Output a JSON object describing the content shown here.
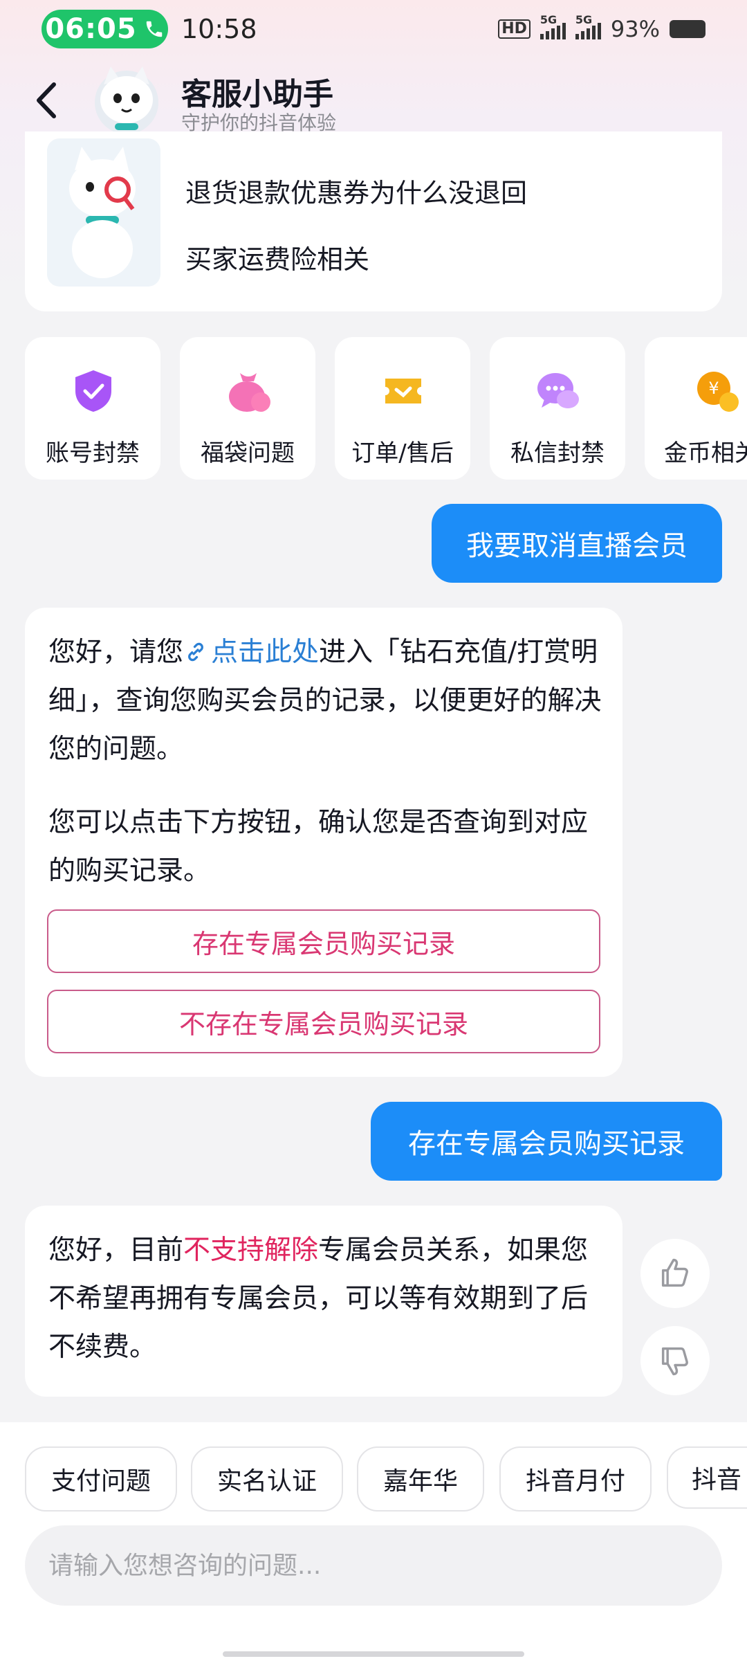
{
  "status_bar": {
    "call_timer": "06:05",
    "time": "10:58",
    "hd_label": "HD",
    "signal_label_1": "5G",
    "signal_label_2": "5G",
    "battery": "93%"
  },
  "header": {
    "title": "客服小助手",
    "subtitle": "守护你的抖音体验"
  },
  "faq": {
    "questions": [
      "退货退款优惠券为什么没退回",
      "买家运费险相关"
    ]
  },
  "categories": [
    {
      "label": "账号封禁",
      "icon": "shield-check-icon",
      "color": "#a855f7"
    },
    {
      "label": "福袋问题",
      "icon": "lucky-bag-icon",
      "color": "#f472b6"
    },
    {
      "label": "订单/售后",
      "icon": "order-ticket-icon",
      "color": "#f5b720"
    },
    {
      "label": "私信封禁",
      "icon": "chat-bubble-icon",
      "color": "#c084fc"
    },
    {
      "label": "金币相关",
      "icon": "gold-coin-icon",
      "color": "#f59e0b"
    }
  ],
  "messages": {
    "user_1": "我要取消直播会员",
    "bot_1": {
      "p1_before": "您好，请您",
      "p1_link": "点击此处",
      "p1_after": "进入「钻石充值/打赏明细」，查询您购买会员的记录，以便更好的解决您的问题。",
      "p2": "您可以点击下方按钮，确认您是否查询到对应的购买记录。",
      "option_1": "存在专属会员购买记录",
      "option_2": "不存在专属会员购买记录"
    },
    "user_2": "存在专属会员购买记录",
    "bot_2": {
      "before": "您好，目前",
      "highlight": "不支持解除",
      "after": "专属会员关系，如果您不希望再拥有专属会员，可以等有效期到了后不续费。"
    }
  },
  "quick_chips": [
    "支付问题",
    "实名认证",
    "嘉年华",
    "抖音月付",
    "抖音"
  ],
  "input": {
    "placeholder": "请输入您想咨询的问题..."
  },
  "colors": {
    "accent_blue": "#1c8df8",
    "highlight_pink": "#e0245e",
    "call_green": "#1fc46a"
  }
}
